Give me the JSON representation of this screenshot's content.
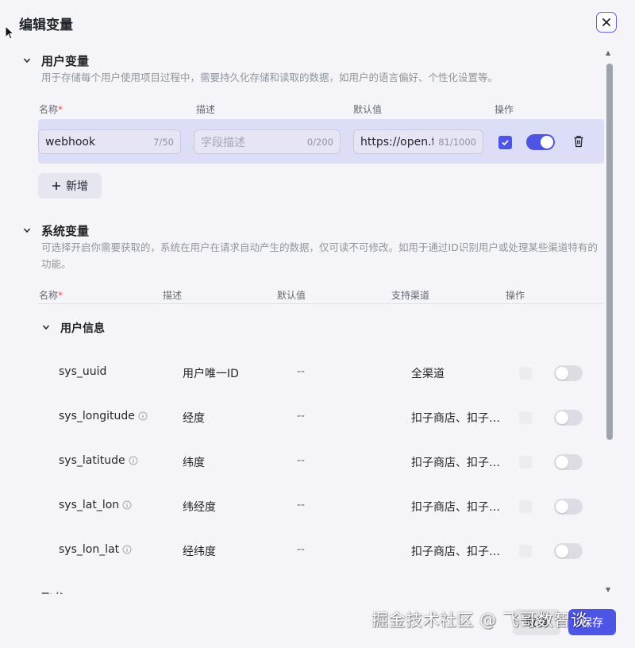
{
  "dialog": {
    "title": "编辑变量",
    "cancel_label": "取消",
    "save_label": "保存"
  },
  "user_vars": {
    "title": "用户变量",
    "description": "用于存储每个用户使用项目过程中，需要持久化存储和读取的数据，如用户的语言偏好、个性化设置等。",
    "columns": {
      "name": "名称",
      "required_mark": "*",
      "desc": "描述",
      "default": "默认值",
      "actions": "操作"
    },
    "row": {
      "name_value": "webhook",
      "name_count": "7/50",
      "desc_placeholder": "字段描述",
      "desc_count": "0/200",
      "default_value": "https://open.fe",
      "default_count": "81/1000",
      "checked": true,
      "enabled": true
    },
    "add_label": "新增"
  },
  "system_vars": {
    "title": "系统变量",
    "description": "可选择开启你需要获取的，系统在用户在请求自动产生的数据，仅可读不可修改。如用于通过ID识别用户或处理某些渠道特有的功能。",
    "columns": {
      "name": "名称",
      "required_mark": "*",
      "desc": "描述",
      "default": "默认值",
      "channels": "支持渠道",
      "actions": "操作"
    },
    "group_title": "用户信息",
    "rows": [
      {
        "name": "sys_uuid",
        "has_info": false,
        "desc": "用户唯一ID",
        "default": "--",
        "channels": "全渠道",
        "enabled": false
      },
      {
        "name": "sys_longitude",
        "has_info": true,
        "desc": "经度",
        "default": "--",
        "channels": "扣子商店、扣子…",
        "enabled": false
      },
      {
        "name": "sys_latitude",
        "has_info": true,
        "desc": "纬度",
        "default": "--",
        "channels": "扣子商店、扣子…",
        "enabled": false
      },
      {
        "name": "sys_lat_lon",
        "has_info": true,
        "desc": "纬经度",
        "default": "--",
        "channels": "扣子商店、扣子…",
        "enabled": false
      },
      {
        "name": "sys_lon_lat",
        "has_info": true,
        "desc": "经纬度",
        "default": "--",
        "channels": "扣子商店、扣子…",
        "enabled": false
      }
    ],
    "next_group_partial": "飞书"
  },
  "watermark": "掘金技术社区 @ 飞哥数智谈",
  "colors": {
    "accent": "#4e54e4",
    "selected_row": "#dcddf7",
    "background": "#f5f5f9"
  }
}
